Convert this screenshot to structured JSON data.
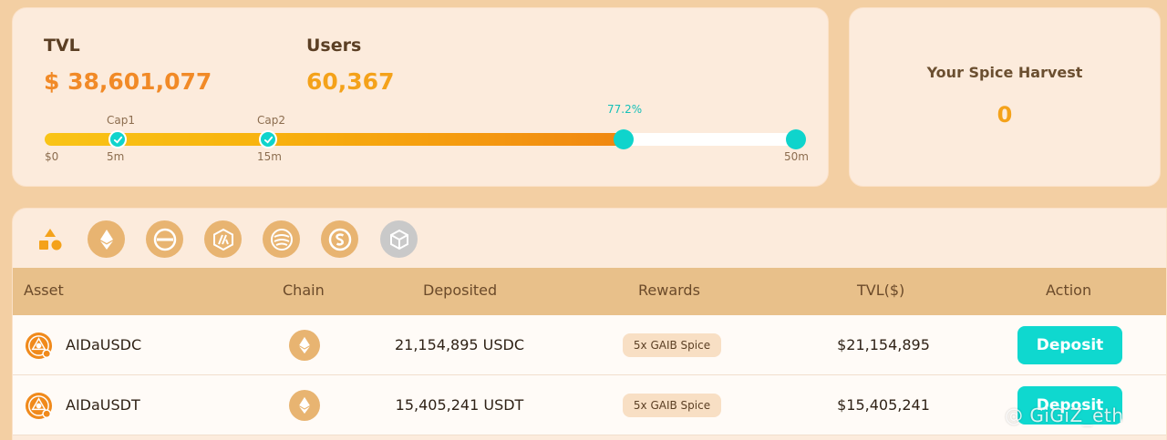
{
  "stats": {
    "tvl_label": "TVL",
    "tvl_value": "$ 38,601,077",
    "users_label": "Users",
    "users_value": "60,367"
  },
  "progress": {
    "percent_label": "77.2%",
    "percent": 77.2,
    "ticks": [
      {
        "label": "$0"
      },
      {
        "label": "5m",
        "cap": "Cap1"
      },
      {
        "label": "15m",
        "cap": "Cap2"
      },
      {
        "label": "50m"
      }
    ],
    "fill_color": "#f59c0f",
    "dot_color": "#0fd4cc"
  },
  "harvest": {
    "title": "Your Spice Harvest",
    "value": "0"
  },
  "filters": [
    {
      "icon": "shapes-icon",
      "selected": true
    },
    {
      "icon": "ethereum-icon"
    },
    {
      "icon": "minus-circle-icon"
    },
    {
      "icon": "arbitrum-icon"
    },
    {
      "icon": "swirl-icon"
    },
    {
      "icon": "dollar-s-icon"
    },
    {
      "icon": "cube-icon"
    }
  ],
  "table": {
    "columns": [
      "Asset",
      "Chain",
      "Deposited",
      "Rewards",
      "TVL($)",
      "Action"
    ],
    "rows": [
      {
        "asset": "AIDaUSDC",
        "chain_icon": "ethereum-icon",
        "deposited": "21,154,895 USDC",
        "rewards": "5x GAIB Spice",
        "tvl": "$21,154,895",
        "action": "Deposit"
      },
      {
        "asset": "AIDaUSDT",
        "chain_icon": "ethereum-icon",
        "deposited": "15,405,241 USDT",
        "rewards": "5x GAIB Spice",
        "tvl": "$15,405,241",
        "action": "Deposit"
      }
    ]
  },
  "watermark": "@ GiGiZ_eth",
  "colors": {
    "accent_teal": "#0fd8cf",
    "tvl_orange": "#f18a27",
    "users_orange": "#f4a21a",
    "card_bg": "#fcebdc",
    "header_bg": "#e8c08a"
  }
}
